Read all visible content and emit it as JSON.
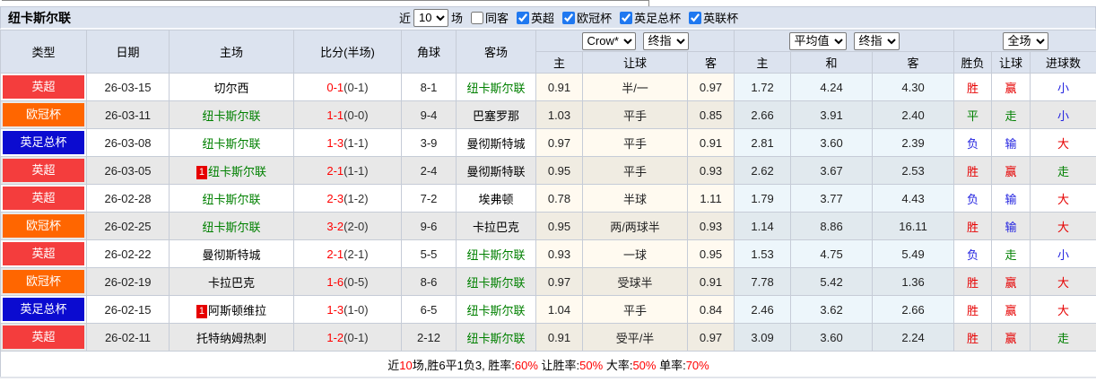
{
  "colors": {
    "league_colors": {
      "英超": "#f43d3d",
      "欧冠杯": "#ff6600",
      "英足总杯": "#0b0bd0"
    },
    "result_colors": {
      "胜": "#e60000",
      "赢": "#e60000",
      "大": "#e60000",
      "平": "#008000",
      "走": "#008000",
      "负": "#2323e0",
      "输": "#2323e0",
      "小": "#2323e0"
    },
    "team_self": "#008000",
    "team_other": "#000000"
  },
  "topbar": {
    "title": "纽卡斯尔联",
    "near_label": "近",
    "near_value": "10",
    "games_label": "场",
    "same_away_label": "同客",
    "leagues": [
      "英超",
      "欧冠杯",
      "英足总杯",
      "英联杯"
    ]
  },
  "header": {
    "cols": [
      "类型",
      "日期",
      "主场",
      "比分(半场)",
      "角球",
      "客场"
    ],
    "selects": {
      "odds_source": "Crow*",
      "odds_time": "终指",
      "avg_source": "平均值",
      "avg_time": "终指",
      "scope": "全场"
    },
    "subcols": [
      "主",
      "让球",
      "客",
      "主",
      "和",
      "客",
      "胜负",
      "让球",
      "进球数"
    ]
  },
  "rows": [
    {
      "league": "英超",
      "date": "26-03-15",
      "home": "切尔西",
      "home_color": "#000000",
      "home_mark": "",
      "score": "0-1",
      "half": "(0-1)",
      "corner": "8-1",
      "away": "纽卡斯尔联",
      "away_color": "#008000",
      "away_mark": "",
      "odds_home": "0.91",
      "handicap": "半/一",
      "odds_away": "0.97",
      "avg_home": "1.72",
      "avg_draw": "4.24",
      "avg_away": "4.30",
      "result": "胜",
      "handicap_result": "赢",
      "goals_result": "小"
    },
    {
      "league": "欧冠杯",
      "date": "26-03-11",
      "home": "纽卡斯尔联",
      "home_color": "#008000",
      "home_mark": "",
      "score": "1-1",
      "half": "(0-0)",
      "corner": "9-4",
      "away": "巴塞罗那",
      "away_color": "#000000",
      "away_mark": "",
      "odds_home": "1.03",
      "handicap": "平手",
      "odds_away": "0.85",
      "avg_home": "2.66",
      "avg_draw": "3.91",
      "avg_away": "2.40",
      "result": "平",
      "handicap_result": "走",
      "goals_result": "小"
    },
    {
      "league": "英足总杯",
      "date": "26-03-08",
      "home": "纽卡斯尔联",
      "home_color": "#008000",
      "home_mark": "",
      "score": "1-3",
      "half": "(1-1)",
      "corner": "3-9",
      "away": "曼彻斯特城",
      "away_color": "#000000",
      "away_mark": "",
      "odds_home": "0.97",
      "handicap": "平手",
      "odds_away": "0.91",
      "avg_home": "2.81",
      "avg_draw": "3.60",
      "avg_away": "2.39",
      "result": "负",
      "handicap_result": "输",
      "goals_result": "大"
    },
    {
      "league": "英超",
      "date": "26-03-05",
      "home": "纽卡斯尔联",
      "home_color": "#008000",
      "home_mark": "1",
      "score": "2-1",
      "half": "(1-1)",
      "corner": "2-4",
      "away": "曼彻斯特联",
      "away_color": "#000000",
      "away_mark": "",
      "odds_home": "0.95",
      "handicap": "平手",
      "odds_away": "0.93",
      "avg_home": "2.62",
      "avg_draw": "3.67",
      "avg_away": "2.53",
      "result": "胜",
      "handicap_result": "赢",
      "goals_result": "走"
    },
    {
      "league": "英超",
      "date": "26-02-28",
      "home": "纽卡斯尔联",
      "home_color": "#008000",
      "home_mark": "",
      "score": "2-3",
      "half": "(1-2)",
      "corner": "7-2",
      "away": "埃弗顿",
      "away_color": "#000000",
      "away_mark": "",
      "odds_home": "0.78",
      "handicap": "半球",
      "odds_away": "1.11",
      "avg_home": "1.79",
      "avg_draw": "3.77",
      "avg_away": "4.43",
      "result": "负",
      "handicap_result": "输",
      "goals_result": "大"
    },
    {
      "league": "欧冠杯",
      "date": "26-02-25",
      "home": "纽卡斯尔联",
      "home_color": "#008000",
      "home_mark": "",
      "score": "3-2",
      "half": "(2-0)",
      "corner": "9-6",
      "away": "卡拉巴克",
      "away_color": "#000000",
      "away_mark": "",
      "odds_home": "0.95",
      "handicap": "两/两球半",
      "odds_away": "0.93",
      "avg_home": "1.14",
      "avg_draw": "8.86",
      "avg_away": "16.11",
      "result": "胜",
      "handicap_result": "输",
      "goals_result": "大"
    },
    {
      "league": "英超",
      "date": "26-02-22",
      "home": "曼彻斯特城",
      "home_color": "#000000",
      "home_mark": "",
      "score": "2-1",
      "half": "(2-1)",
      "corner": "5-5",
      "away": "纽卡斯尔联",
      "away_color": "#008000",
      "away_mark": "",
      "odds_home": "0.93",
      "handicap": "一球",
      "odds_away": "0.95",
      "avg_home": "1.53",
      "avg_draw": "4.75",
      "avg_away": "5.49",
      "result": "负",
      "handicap_result": "走",
      "goals_result": "小"
    },
    {
      "league": "欧冠杯",
      "date": "26-02-19",
      "home": "卡拉巴克",
      "home_color": "#000000",
      "home_mark": "",
      "score": "1-6",
      "half": "(0-5)",
      "corner": "8-6",
      "away": "纽卡斯尔联",
      "away_color": "#008000",
      "away_mark": "",
      "odds_home": "0.97",
      "handicap": "受球半",
      "odds_away": "0.91",
      "avg_home": "7.78",
      "avg_draw": "5.42",
      "avg_away": "1.36",
      "result": "胜",
      "handicap_result": "赢",
      "goals_result": "大"
    },
    {
      "league": "英足总杯",
      "date": "26-02-15",
      "home": "阿斯顿维拉",
      "home_color": "#000000",
      "home_mark": "1",
      "score": "1-3",
      "half": "(1-0)",
      "corner": "6-5",
      "away": "纽卡斯尔联",
      "away_color": "#008000",
      "away_mark": "",
      "odds_home": "1.04",
      "handicap": "平手",
      "odds_away": "0.84",
      "avg_home": "2.46",
      "avg_draw": "3.62",
      "avg_away": "2.66",
      "result": "胜",
      "handicap_result": "赢",
      "goals_result": "大"
    },
    {
      "league": "英超",
      "date": "26-02-11",
      "home": "托特纳姆热刺",
      "home_color": "#000000",
      "home_mark": "",
      "score": "1-2",
      "half": "(0-1)",
      "corner": "2-12",
      "away": "纽卡斯尔联",
      "away_color": "#008000",
      "away_mark": "",
      "odds_home": "0.91",
      "handicap": "受平/半",
      "odds_away": "0.97",
      "avg_home": "3.09",
      "avg_draw": "3.60",
      "avg_away": "2.24",
      "result": "胜",
      "handicap_result": "赢",
      "goals_result": "走"
    }
  ],
  "footer": {
    "segments": [
      {
        "text": "近",
        "red": false
      },
      {
        "text": "10",
        "red": true
      },
      {
        "text": "场,胜6平1负3, 胜率:",
        "red": false
      },
      {
        "text": "60%",
        "red": true
      },
      {
        "text": " 让胜率:",
        "red": false
      },
      {
        "text": "50%",
        "red": true
      },
      {
        "text": " 大率:",
        "red": false
      },
      {
        "text": "50%",
        "red": true
      },
      {
        "text": " 单率:",
        "red": false
      },
      {
        "text": "70%",
        "red": true
      }
    ]
  }
}
